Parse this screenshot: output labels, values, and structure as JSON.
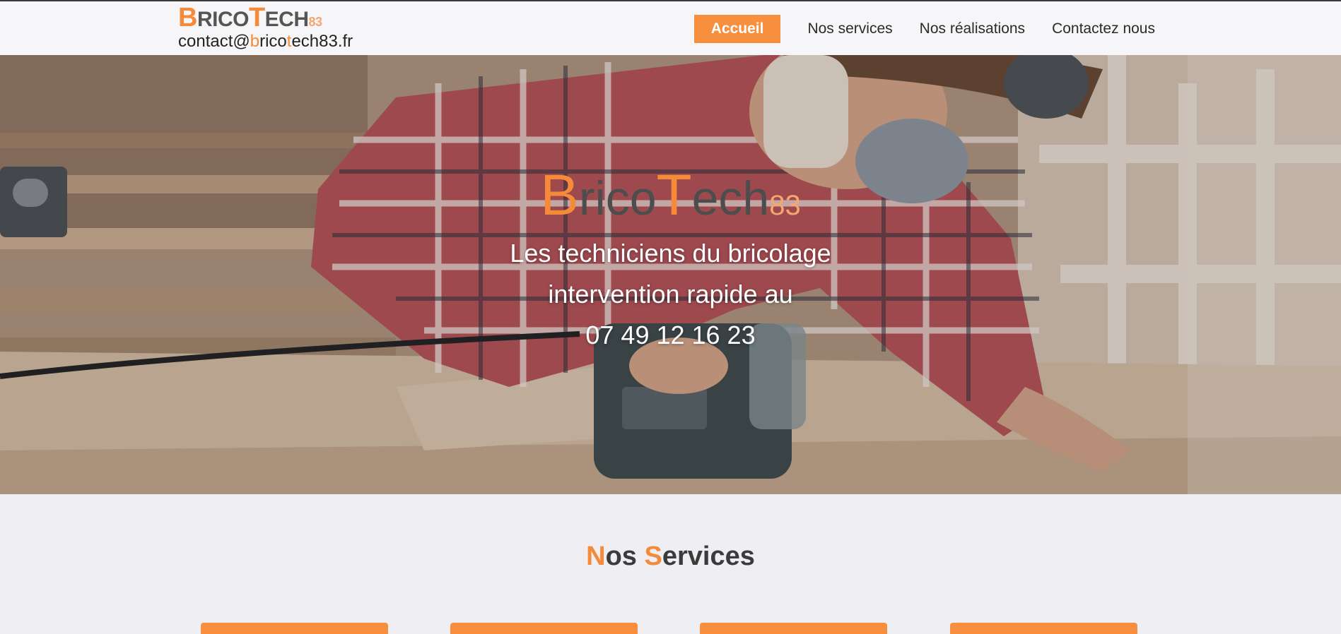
{
  "header": {
    "logo": {
      "b": "B",
      "rico": "RICO",
      "t": "T",
      "ech": "ECH",
      "suffix": "83"
    },
    "email": {
      "p1": "contact@",
      "p2": "b",
      "p3": "rico",
      "p4": "t",
      "p5": "ech83.fr"
    }
  },
  "nav": {
    "items": [
      {
        "label": "Accueil",
        "active": true
      },
      {
        "label": "Nos services"
      },
      {
        "label": "Nos réalisations"
      },
      {
        "label": "Contactez nous"
      }
    ]
  },
  "hero": {
    "logo": {
      "b": "B",
      "rico": "rico",
      "t": "T",
      "ech": "ech",
      "suffix": "83"
    },
    "line1": "Les techniciens du bricolage",
    "line2": "intervention rapide au",
    "phone": "07 49 12 16 23"
  },
  "services": {
    "title_n": "N",
    "title_os": "os ",
    "title_s": "S",
    "title_ervices": "ervices",
    "card_count": 4
  },
  "colors": {
    "accent": "#f78f3e",
    "brand_orange": "#f58a38",
    "brand_suffix": "#f5a671",
    "header_bg": "#f6f6f9",
    "page_bg": "#efeef2"
  }
}
